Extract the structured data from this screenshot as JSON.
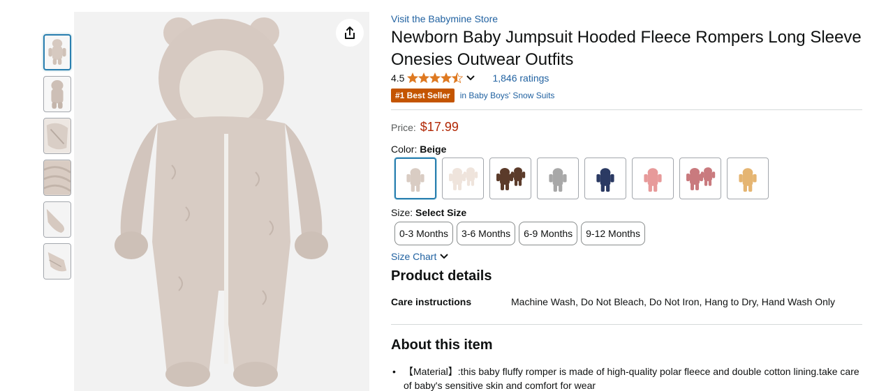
{
  "store": {
    "link_text": "Visit the Babymine Store"
  },
  "product": {
    "title": "Newborn Baby Jumpsuit Hooded Fleece Rompers Long Sleeve Onesies Outwear Outfits",
    "rating": "4.5",
    "ratings_count": "1,846 ratings",
    "badge": "#1 Best Seller",
    "badge_category": "in Baby Boys' Snow Suits"
  },
  "price": {
    "label": "Price:",
    "value": "$17.99"
  },
  "color": {
    "label": "Color:",
    "selected": "Beige",
    "swatches": [
      "#d9ccc3",
      "#efe4dc",
      "#5b3b2a",
      "#a8a8a8",
      "#2b3a63",
      "#e79a9a",
      "#c97a7e",
      "#e5b572"
    ]
  },
  "size": {
    "label": "Size:",
    "selected": "Select Size",
    "options": [
      "0-3 Months",
      "3-6 Months",
      "6-9 Months",
      "9-12 Months"
    ]
  },
  "size_chart": "Size Chart",
  "details": {
    "title": "Product details",
    "care_label": "Care instructions",
    "care_value": "Machine Wash, Do Not Bleach, Do Not Iron, Hang to Dry, Hand Wash Only"
  },
  "about": {
    "title": "About this item",
    "bullets": [
      "【Material】:this baby fluffy romper is made of high-quality polar fleece and double cotton lining.take care of baby's sensitive skin and comfort for wear"
    ]
  },
  "colors": {
    "link": "#2162a1",
    "price": "#b12704",
    "badge": "#c45500",
    "star": "#de7921"
  }
}
